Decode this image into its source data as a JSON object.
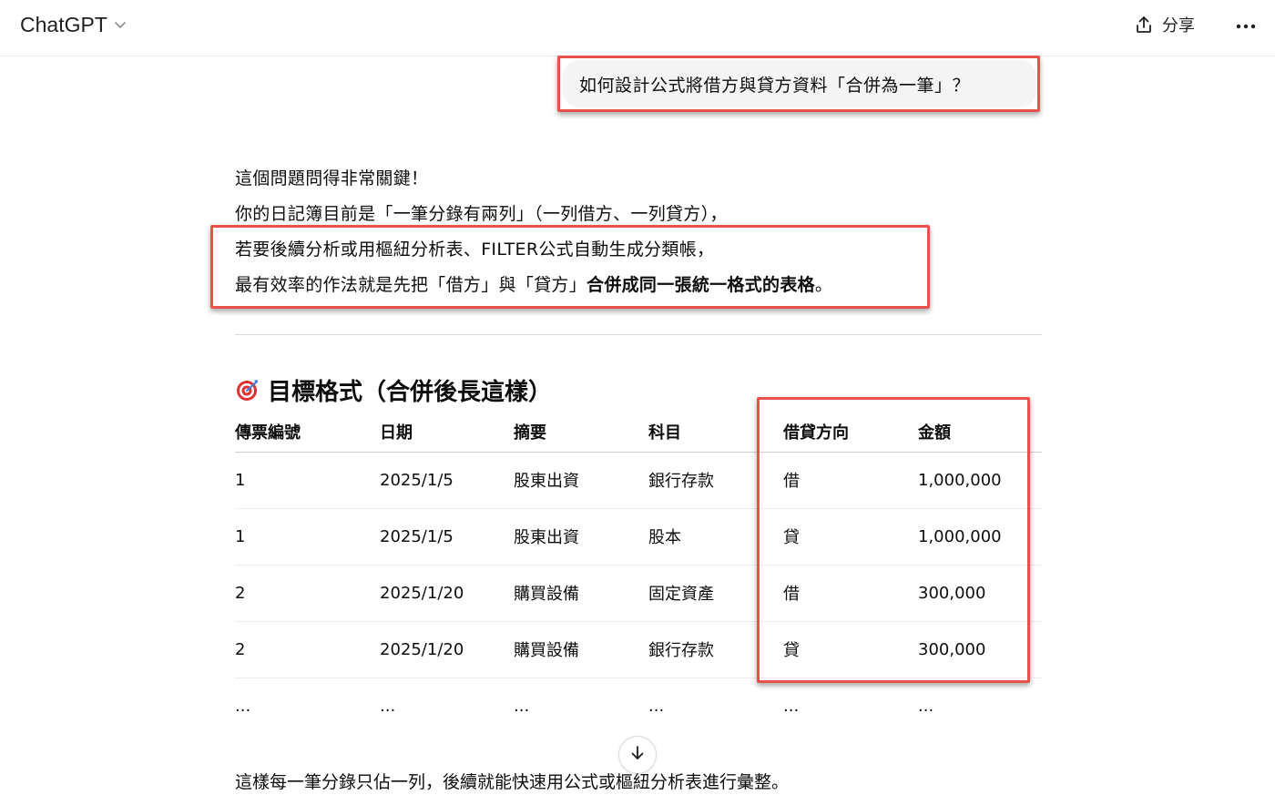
{
  "header": {
    "model_name": "ChatGPT",
    "share_label": "分享",
    "icons": {
      "model": "chevron-down-icon",
      "share": "share-upload-icon",
      "more": "more-horizontal-icon"
    }
  },
  "user_message": "如何設計公式將借方與貸方資料「合併為一筆」？",
  "answer": {
    "lines": [
      "這個問題問得非常關鍵！",
      "你的日記簿目前是「一筆分錄有兩列」（一列借方、一列貸方），",
      "若要後續分析或用樞紐分析表、FILTER公式自動生成分類帳，",
      "最有效率的作法就是先把「借方」與「貸方」"
    ],
    "line4_bold": "合併成同一張統一格式的表格",
    "line4_tail": "。",
    "heading": "目標格式（合併後長這樣）",
    "heading_icon": "target-dart-icon",
    "closing": "這樣每一筆分錄只佔一列，後續就能快速用公式或樞紐分析表進行彙整。"
  },
  "table": {
    "headers": [
      "傳票編號",
      "日期",
      "摘要",
      "科目",
      "借貸方向",
      "金額"
    ],
    "rows": [
      [
        "1",
        "2025/1/5",
        "股東出資",
        "銀行存款",
        "借",
        "1,000,000"
      ],
      [
        "1",
        "2025/1/5",
        "股東出資",
        "股本",
        "貸",
        "1,000,000"
      ],
      [
        "2",
        "2025/1/20",
        "購買設備",
        "固定資產",
        "借",
        "300,000"
      ],
      [
        "2",
        "2025/1/20",
        "購買設備",
        "銀行存款",
        "貸",
        "300,000"
      ],
      [
        "...",
        "...",
        "...",
        "...",
        "...",
        "..."
      ]
    ]
  },
  "highlight_color": "#e8524a",
  "scroll_icon": "arrow-down-icon"
}
